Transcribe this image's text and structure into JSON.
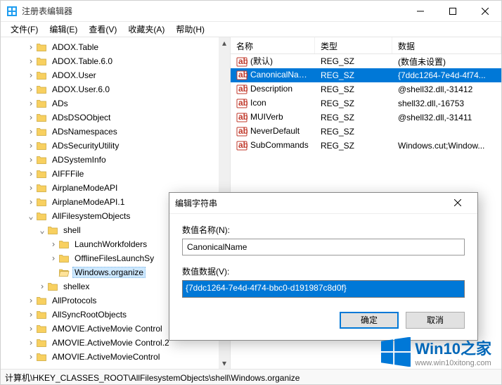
{
  "window": {
    "title": "注册表编辑器"
  },
  "menu": {
    "file": "文件(F)",
    "edit": "编辑(E)",
    "view": "查看(V)",
    "favorites": "收藏夹(A)",
    "help": "帮助(H)"
  },
  "tree": {
    "items": [
      {
        "depth": 2,
        "twisty": ">",
        "label": "ADOX.Table"
      },
      {
        "depth": 2,
        "twisty": ">",
        "label": "ADOX.Table.6.0"
      },
      {
        "depth": 2,
        "twisty": ">",
        "label": "ADOX.User"
      },
      {
        "depth": 2,
        "twisty": ">",
        "label": "ADOX.User.6.0"
      },
      {
        "depth": 2,
        "twisty": ">",
        "label": "ADs"
      },
      {
        "depth": 2,
        "twisty": ">",
        "label": "ADsDSOObject"
      },
      {
        "depth": 2,
        "twisty": ">",
        "label": "ADsNamespaces"
      },
      {
        "depth": 2,
        "twisty": ">",
        "label": "ADsSecurityUtility"
      },
      {
        "depth": 2,
        "twisty": ">",
        "label": "ADSystemInfo"
      },
      {
        "depth": 2,
        "twisty": ">",
        "label": "AIFFFile"
      },
      {
        "depth": 2,
        "twisty": ">",
        "label": "AirplaneModeAPI"
      },
      {
        "depth": 2,
        "twisty": ">",
        "label": "AirplaneModeAPI.1"
      },
      {
        "depth": 2,
        "twisty": "v",
        "label": "AllFilesystemObjects"
      },
      {
        "depth": 3,
        "twisty": "v",
        "label": "shell"
      },
      {
        "depth": 4,
        "twisty": ">",
        "label": "LaunchWorkfolders"
      },
      {
        "depth": 4,
        "twisty": ">",
        "label": "OfflineFilesLaunchSy"
      },
      {
        "depth": 4,
        "twisty": "",
        "label": "Windows.organize",
        "selected": true,
        "open": true
      },
      {
        "depth": 3,
        "twisty": ">",
        "label": "shellex"
      },
      {
        "depth": 2,
        "twisty": ">",
        "label": "AllProtocols"
      },
      {
        "depth": 2,
        "twisty": ">",
        "label": "AllSyncRootObjects"
      },
      {
        "depth": 2,
        "twisty": ">",
        "label": "AMOVIE.ActiveMovie Control"
      },
      {
        "depth": 2,
        "twisty": ">",
        "label": "AMOVIE.ActiveMovie Control.2"
      },
      {
        "depth": 2,
        "twisty": ">",
        "label": "AMOVIE.ActiveMovieControl"
      }
    ]
  },
  "list": {
    "cols": {
      "name": "名称",
      "type": "类型",
      "data": "数据"
    },
    "rows": [
      {
        "name": "(默认)",
        "type": "REG_SZ",
        "data": "(数值未设置)"
      },
      {
        "name": "CanonicalName",
        "type": "REG_SZ",
        "data": "{7ddc1264-7e4d-4f74...",
        "selected": true
      },
      {
        "name": "Description",
        "type": "REG_SZ",
        "data": "@shell32.dll,-31412"
      },
      {
        "name": "Icon",
        "type": "REG_SZ",
        "data": "shell32.dll,-16753"
      },
      {
        "name": "MUIVerb",
        "type": "REG_SZ",
        "data": "@shell32.dll,-31411"
      },
      {
        "name": "NeverDefault",
        "type": "REG_SZ",
        "data": ""
      },
      {
        "name": "SubCommands",
        "type": "REG_SZ",
        "data": "Windows.cut;Window..."
      }
    ]
  },
  "dialog": {
    "title": "编辑字符串",
    "name_label": "数值名称(N):",
    "name_value": "CanonicalName",
    "data_label": "数值数据(V):",
    "data_value": "{7ddc1264-7e4d-4f74-bbc0-d191987c8d0f}",
    "ok": "确定",
    "cancel": "取消"
  },
  "statusbar": {
    "path": "计算机\\HKEY_CLASSES_ROOT\\AllFilesystemObjects\\shell\\Windows.organize"
  },
  "watermark": {
    "name": "Win10之家",
    "url": "www.win10xitong.com"
  }
}
